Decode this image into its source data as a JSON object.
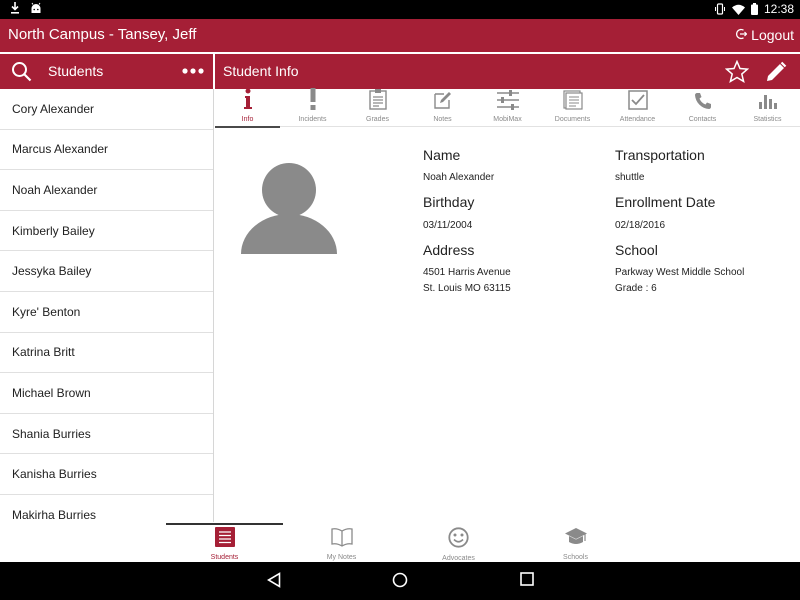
{
  "status_bar": {
    "time": "12:38"
  },
  "app_bar": {
    "title": "North Campus - Tansey, Jeff",
    "logout_label": "Logout"
  },
  "list_header": {
    "title": "Students"
  },
  "detail_header": {
    "title": "Student Info"
  },
  "students": [
    "Cory Alexander",
    "Marcus Alexander",
    "Noah Alexander",
    "Kimberly Bailey",
    "Jessyka Bailey",
    "Kyre' Benton",
    "Katrina Britt",
    "Michael Brown",
    "Shania Burries",
    "Kanisha Burries",
    "Makirha Burries"
  ],
  "tabs": [
    {
      "label": "Info",
      "icon": "info-icon",
      "active": true
    },
    {
      "label": "Incidents",
      "icon": "exclamation-icon"
    },
    {
      "label": "Grades",
      "icon": "clipboard-icon"
    },
    {
      "label": "Notes",
      "icon": "edit-note-icon"
    },
    {
      "label": "MobiMax",
      "icon": "sliders-icon"
    },
    {
      "label": "Documents",
      "icon": "documents-icon"
    },
    {
      "label": "Attendance",
      "icon": "checkbox-icon"
    },
    {
      "label": "Contacts",
      "icon": "phone-icon"
    },
    {
      "label": "Statistics",
      "icon": "bar-chart-icon"
    }
  ],
  "student": {
    "name_label": "Name",
    "name": "Noah Alexander",
    "birthday_label": "Birthday",
    "birthday": "03/11/2004",
    "address_label": "Address",
    "address_line1": "4501 Harris Avenue",
    "address_line2": "St. Louis MO 63115",
    "transportation_label": "Transportation",
    "transportation": "shuttle",
    "enrollment_label": "Enrollment Date",
    "enrollment_date": "02/18/2016",
    "school_label": "School",
    "school": "Parkway West Middle School",
    "grade": "Grade : 6"
  },
  "bottom_nav": [
    {
      "label": "Students",
      "icon": "list-icon",
      "active": true
    },
    {
      "label": "My Notes",
      "icon": "book-icon"
    },
    {
      "label": "Advocates",
      "icon": "smiley-icon"
    },
    {
      "label": "Schools",
      "icon": "graduation-cap-icon"
    }
  ],
  "colors": {
    "brand": "#a51f36",
    "inactive": "#8a8a8a"
  }
}
